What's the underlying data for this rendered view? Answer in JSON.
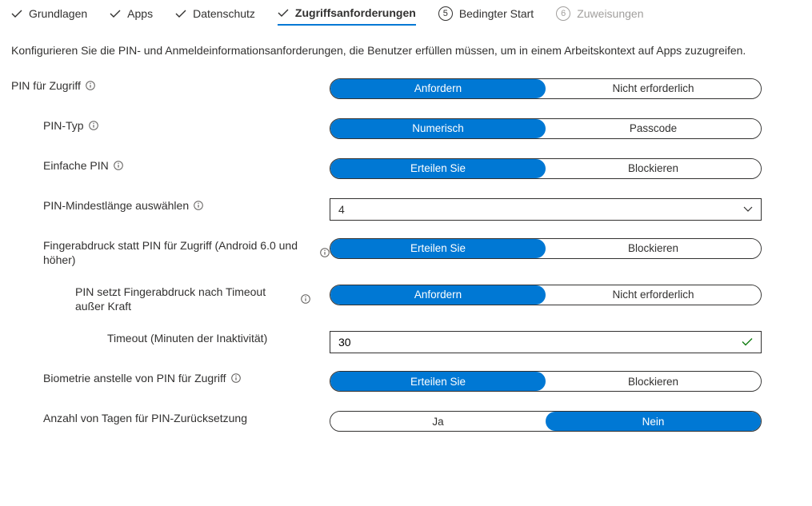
{
  "tabs": {
    "t1": "Grundlagen",
    "t2": "Apps",
    "t3": "Datenschutz",
    "t4": "Zugriffsanforderungen",
    "t5_num": "5",
    "t5": "Bedingter Start",
    "t6_num": "6",
    "t6": "Zuweisungen"
  },
  "description": "Konfigurieren Sie die PIN- und Anmeldeinformationsanforderungen, die Benutzer erfüllen müssen, um in einem Arbeitskontext auf Apps zuzugreifen.",
  "rows": {
    "pin_access": {
      "label": "PIN für Zugriff",
      "opt1": "Anfordern",
      "opt2": "Nicht erforderlich"
    },
    "pin_type": {
      "label": "PIN-Typ",
      "opt1": "Numerisch",
      "opt2": "Passcode"
    },
    "simple_pin": {
      "label": "Einfache PIN",
      "opt1": "Erteilen Sie",
      "opt2": "Blockieren"
    },
    "min_length": {
      "label": "PIN-Mindestlänge auswählen",
      "value": "4"
    },
    "fingerprint": {
      "label": "Fingerabdruck statt PIN für Zugriff (Android 6.0 und höher)",
      "opt1": "Erteilen Sie",
      "opt2": "Blockieren"
    },
    "override": {
      "label": "PIN setzt Fingerabdruck nach Timeout außer Kraft",
      "opt1": "Anfordern",
      "opt2": "Nicht erforderlich"
    },
    "timeout": {
      "label": "Timeout (Minuten der Inaktivität)",
      "value": "30"
    },
    "biometrics": {
      "label": "Biometrie anstelle von PIN für Zugriff",
      "opt1": "Erteilen Sie",
      "opt2": "Blockieren"
    },
    "reset_days": {
      "label": "Anzahl von Tagen für PIN-Zurücksetzung",
      "opt1": "Ja",
      "opt2": "Nein"
    }
  }
}
